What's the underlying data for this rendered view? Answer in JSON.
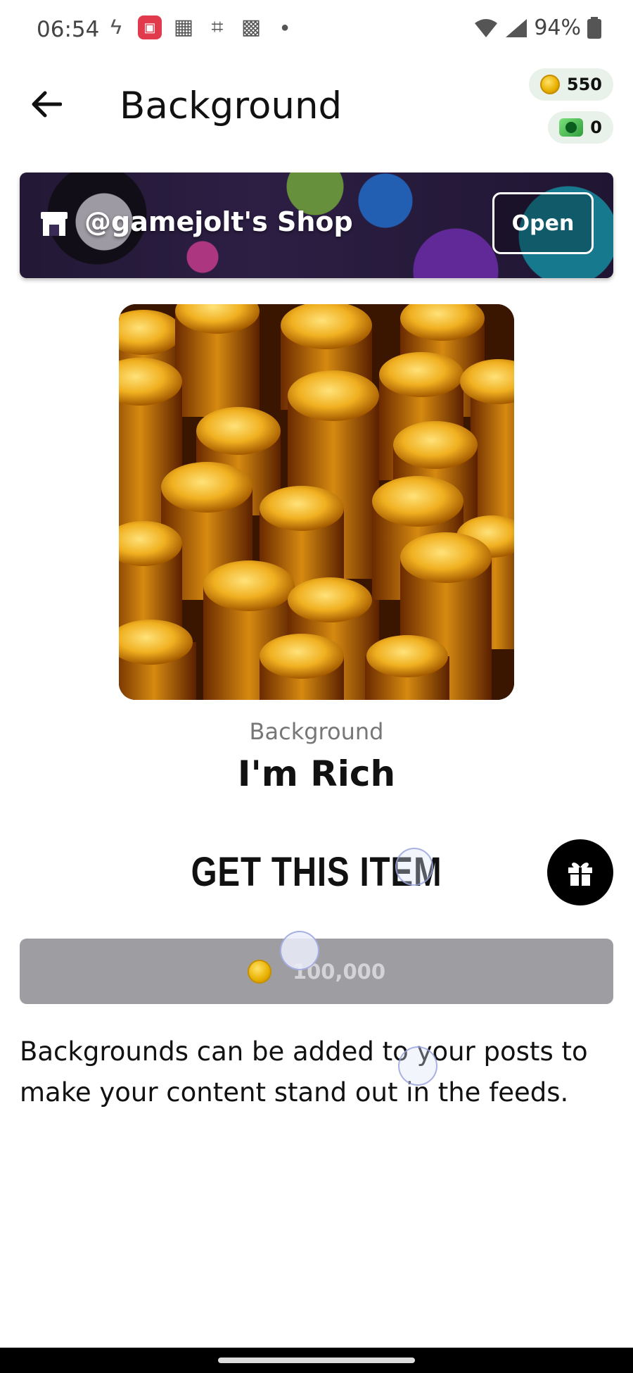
{
  "status_bar": {
    "time": "06:54",
    "battery": "94%"
  },
  "header": {
    "title": "Background",
    "coins": "550",
    "gems": "0"
  },
  "shop": {
    "name": "@gamejolt's Shop",
    "open_label": "Open"
  },
  "item": {
    "type": "Background",
    "name": "I'm Rich",
    "image_icon": "gold-coins-image"
  },
  "purchase": {
    "title": "GET THIS ITEM",
    "price": "100,000"
  },
  "description": "Backgrounds can be added to your posts to make your content stand out in the feeds.",
  "colors": {
    "coin_gold": "#e9b100",
    "pill_bg": "#e8f1ea",
    "buy_button_disabled": "#9e9ea2"
  }
}
